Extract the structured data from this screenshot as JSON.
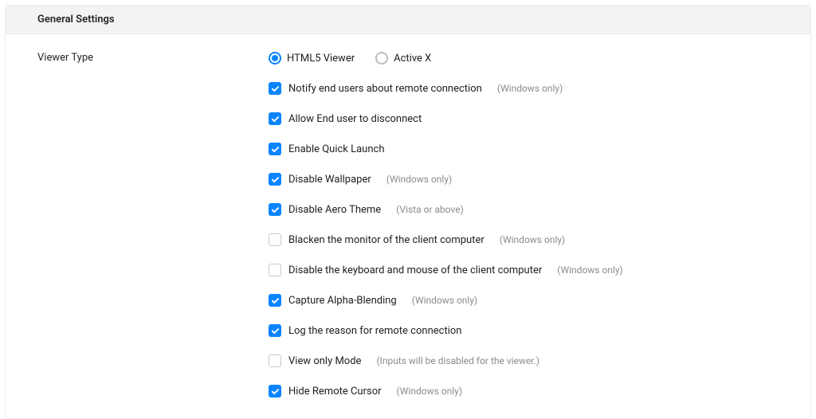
{
  "panel": {
    "title": "General Settings"
  },
  "viewerType": {
    "label": "Viewer Type",
    "options": [
      {
        "label": "HTML5 Viewer",
        "selected": true
      },
      {
        "label": "Active X",
        "selected": false
      }
    ]
  },
  "checkboxes": [
    {
      "label": "Notify end users about remote connection",
      "checked": true,
      "note": "(Windows only)"
    },
    {
      "label": "Allow End user to disconnect",
      "checked": true,
      "note": ""
    },
    {
      "label": "Enable Quick Launch",
      "checked": true,
      "note": ""
    },
    {
      "label": "Disable Wallpaper",
      "checked": true,
      "note": "(Windows only)"
    },
    {
      "label": "Disable Aero Theme",
      "checked": true,
      "note": "(Vista or above)"
    },
    {
      "label": "Blacken the monitor of the client computer",
      "checked": false,
      "note": "(Windows only)"
    },
    {
      "label": "Disable the keyboard and mouse of the client computer",
      "checked": false,
      "note": "(Windows only)"
    },
    {
      "label": "Capture Alpha-Blending",
      "checked": true,
      "note": "(Windows only)"
    },
    {
      "label": "Log the reason for remote connection",
      "checked": true,
      "note": ""
    },
    {
      "label": "View only Mode",
      "checked": false,
      "note": "(Inputs will be disabled for the viewer.)"
    },
    {
      "label": "Hide Remote Cursor",
      "checked": true,
      "note": "(Windows only)"
    }
  ]
}
